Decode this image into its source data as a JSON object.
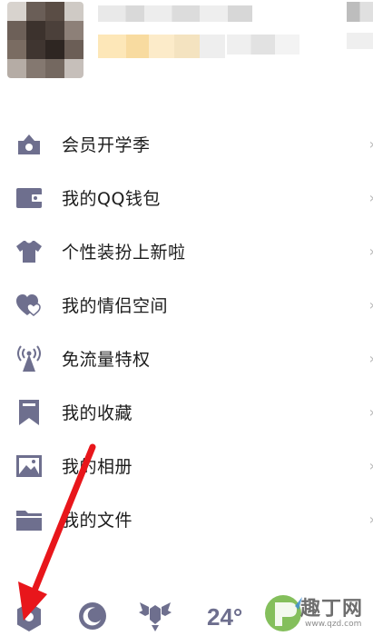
{
  "menu": {
    "items": [
      {
        "label": "会员开学季",
        "icon": "vip-crown-icon",
        "chevron": "›"
      },
      {
        "label": "我的QQ钱包",
        "icon": "wallet-icon",
        "chevron": "›"
      },
      {
        "label": "个性装扮上新啦",
        "icon": "tshirt-icon",
        "chevron": "›"
      },
      {
        "label": "我的情侣空间",
        "icon": "hearts-icon",
        "chevron": "›"
      },
      {
        "label": "免流量特权",
        "icon": "signal-tower-icon",
        "chevron": "›"
      },
      {
        "label": "我的收藏",
        "icon": "bookmark-icon",
        "chevron": "›"
      },
      {
        "label": "我的相册",
        "icon": "photo-album-icon",
        "chevron": "›"
      },
      {
        "label": "我的文件",
        "icon": "folder-icon",
        "chevron": "›"
      }
    ]
  },
  "bottom_bar": {
    "settings_icon": "settings-gear-icon",
    "night_mode_icon": "moon-icon",
    "wings_icon": "wings-badge-icon",
    "weather_temp": "24°"
  },
  "watermark": {
    "text": "趣丁网",
    "url": "www.qzd.com"
  },
  "colors": {
    "icon": "#6e6f8e",
    "annotation_arrow": "#e8161b",
    "chevron": "#b9b9b9"
  }
}
